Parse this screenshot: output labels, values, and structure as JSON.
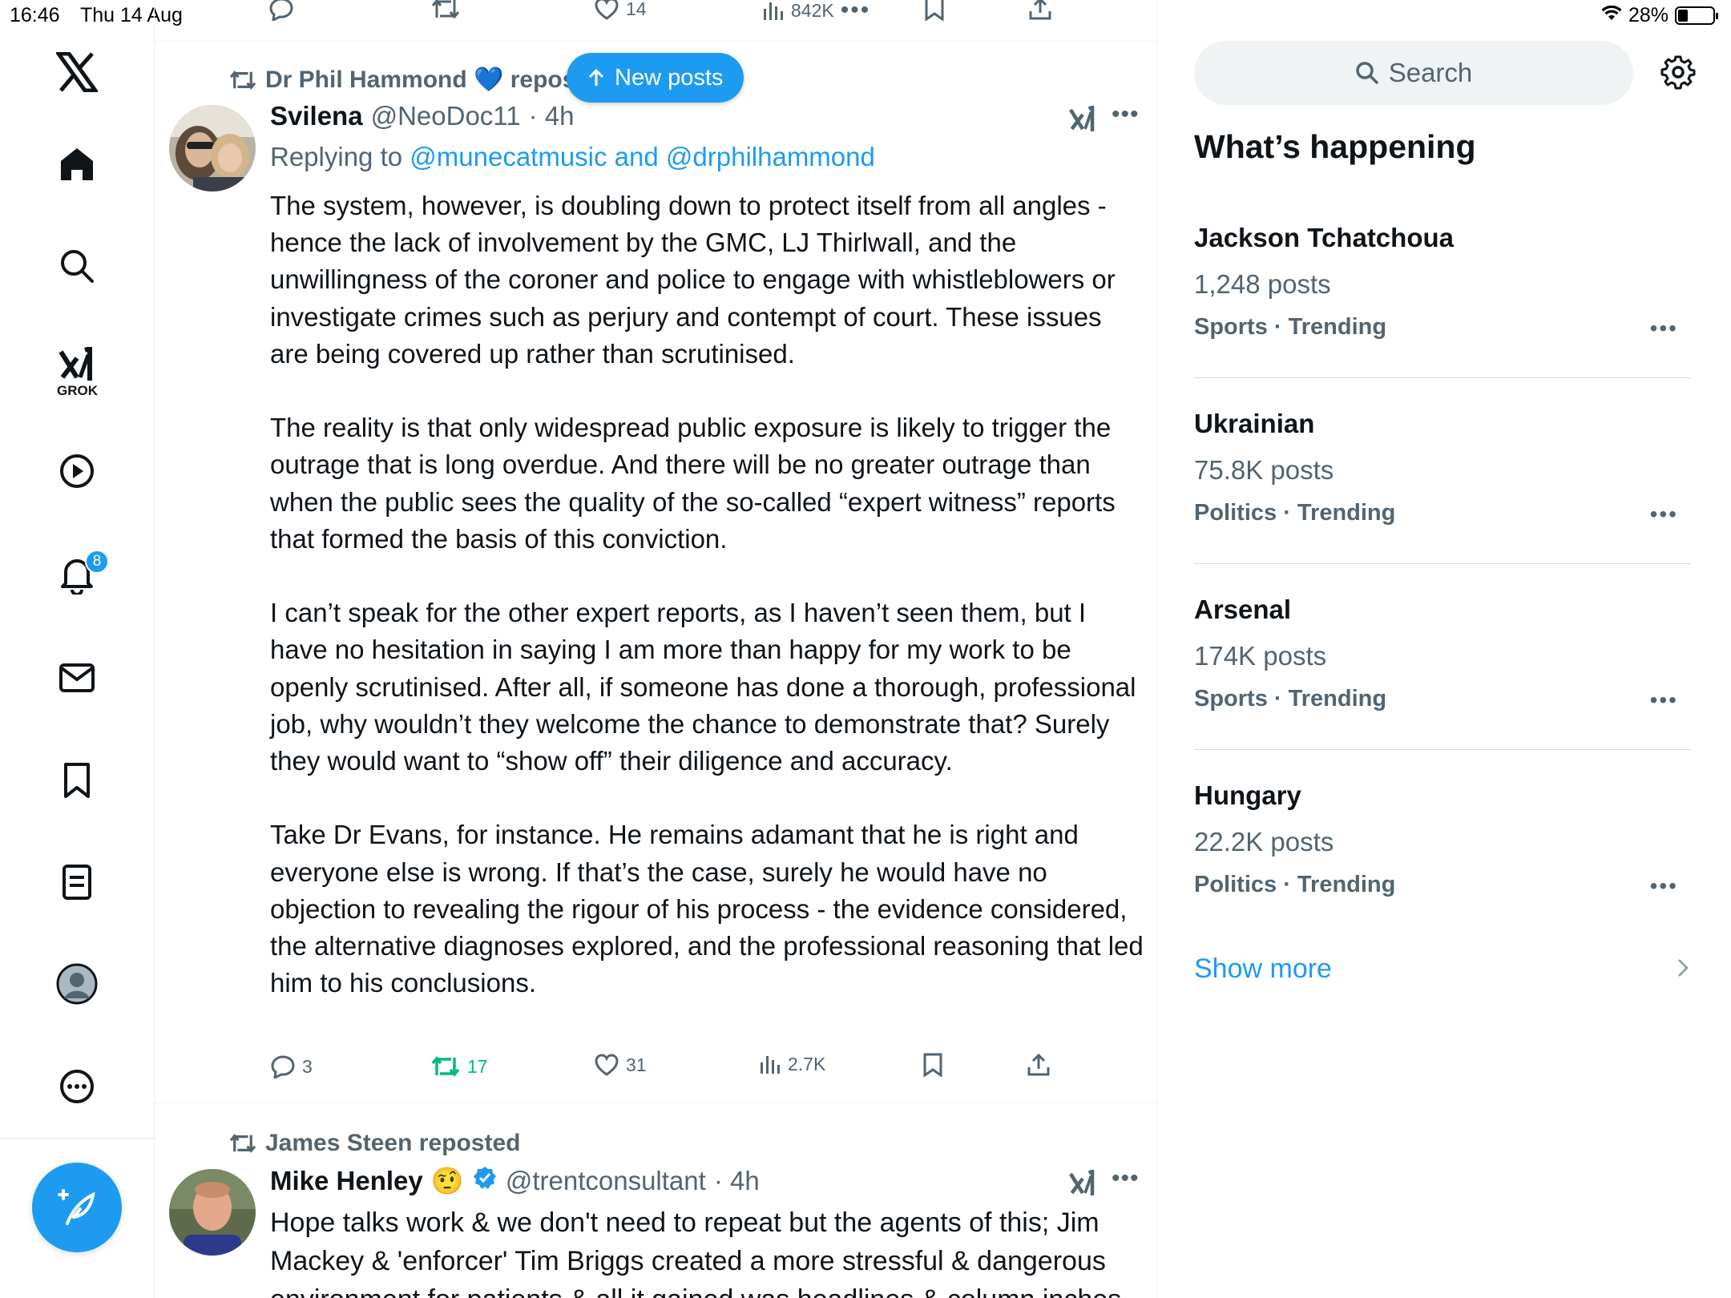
{
  "status_bar": {
    "time": "16:46",
    "date": "Thu 14 Aug",
    "battery": "28%"
  },
  "nav": {
    "grok_label": "GROK",
    "notifications_badge": "8"
  },
  "top_actions": {
    "likes": "14",
    "views": "842K"
  },
  "new_posts_label": "New posts",
  "post1": {
    "reposted_by": "Dr Phil Hammond 💙 repos",
    "author_name": "Svilena",
    "handle": "@NeoDoc11",
    "time": "· 4h",
    "replying_prefix": "Replying to ",
    "replying_to": "@munecatmusic and @drphilhammond",
    "body": "The system, however, is doubling down to protect itself from all angles - hence the lack of involvement by the GMC, LJ Thirlwall, and the unwillingness of the coroner and police to engage with whistleblowers or investigate crimes such as perjury and contempt of court. These issues are being covered up rather than scrutinised.\n\nThe reality is that only widespread public exposure is likely to trigger the outrage that is long overdue. And there will be no greater outrage than when the public sees the quality of the so-called “expert witness” reports that formed the basis of this conviction.\n\nI can’t speak for the other expert reports, as I haven’t seen them, but I have no hesitation in saying I am more than happy for my work to be openly scrutinised. After all, if someone has done a thorough, professional job, why wouldn’t they welcome the chance to demonstrate that? Surely they would want to “show off” their diligence and accuracy.\n\nTake Dr Evans, for instance. He remains adamant that he is right and everyone else is wrong. If that’s the case, surely he would have no objection to revealing the rigour of his process - the evidence considered, the alternative diagnoses explored, and the professional reasoning that led him to his conclusions.",
    "replies": "3",
    "reposts": "17",
    "likes": "31",
    "views": "2.7K"
  },
  "post2": {
    "reposted_by": "James Steen reposted",
    "author_name": "Mike Henley",
    "emoji": "🤨",
    "handle": "@trentconsultant",
    "time": "· 4h",
    "body": "Hope talks work & we don't need to repeat but the agents of this; Jim Mackey & 'enforcer' Tim Briggs created a more stressful & dangerous environment for patients & all it gained was headlines & column inches"
  },
  "sidebar": {
    "search_placeholder": "Search",
    "title": "What’s happening",
    "trends": [
      {
        "name": "Jackson Tchatchoua",
        "count": "1,248 posts",
        "category": "Sports · Trending"
      },
      {
        "name": "Ukrainian",
        "count": "75.8K posts",
        "category": "Politics · Trending"
      },
      {
        "name": "Arsenal",
        "count": "174K posts",
        "category": "Sports · Trending"
      },
      {
        "name": "Hungary",
        "count": "22.2K posts",
        "category": "Politics · Trending"
      }
    ],
    "show_more": "Show more"
  },
  "colors": {
    "accent": "#1d9bf0",
    "repost_green": "#00ba7c",
    "muted": "#536471",
    "text": "#0f1419"
  }
}
